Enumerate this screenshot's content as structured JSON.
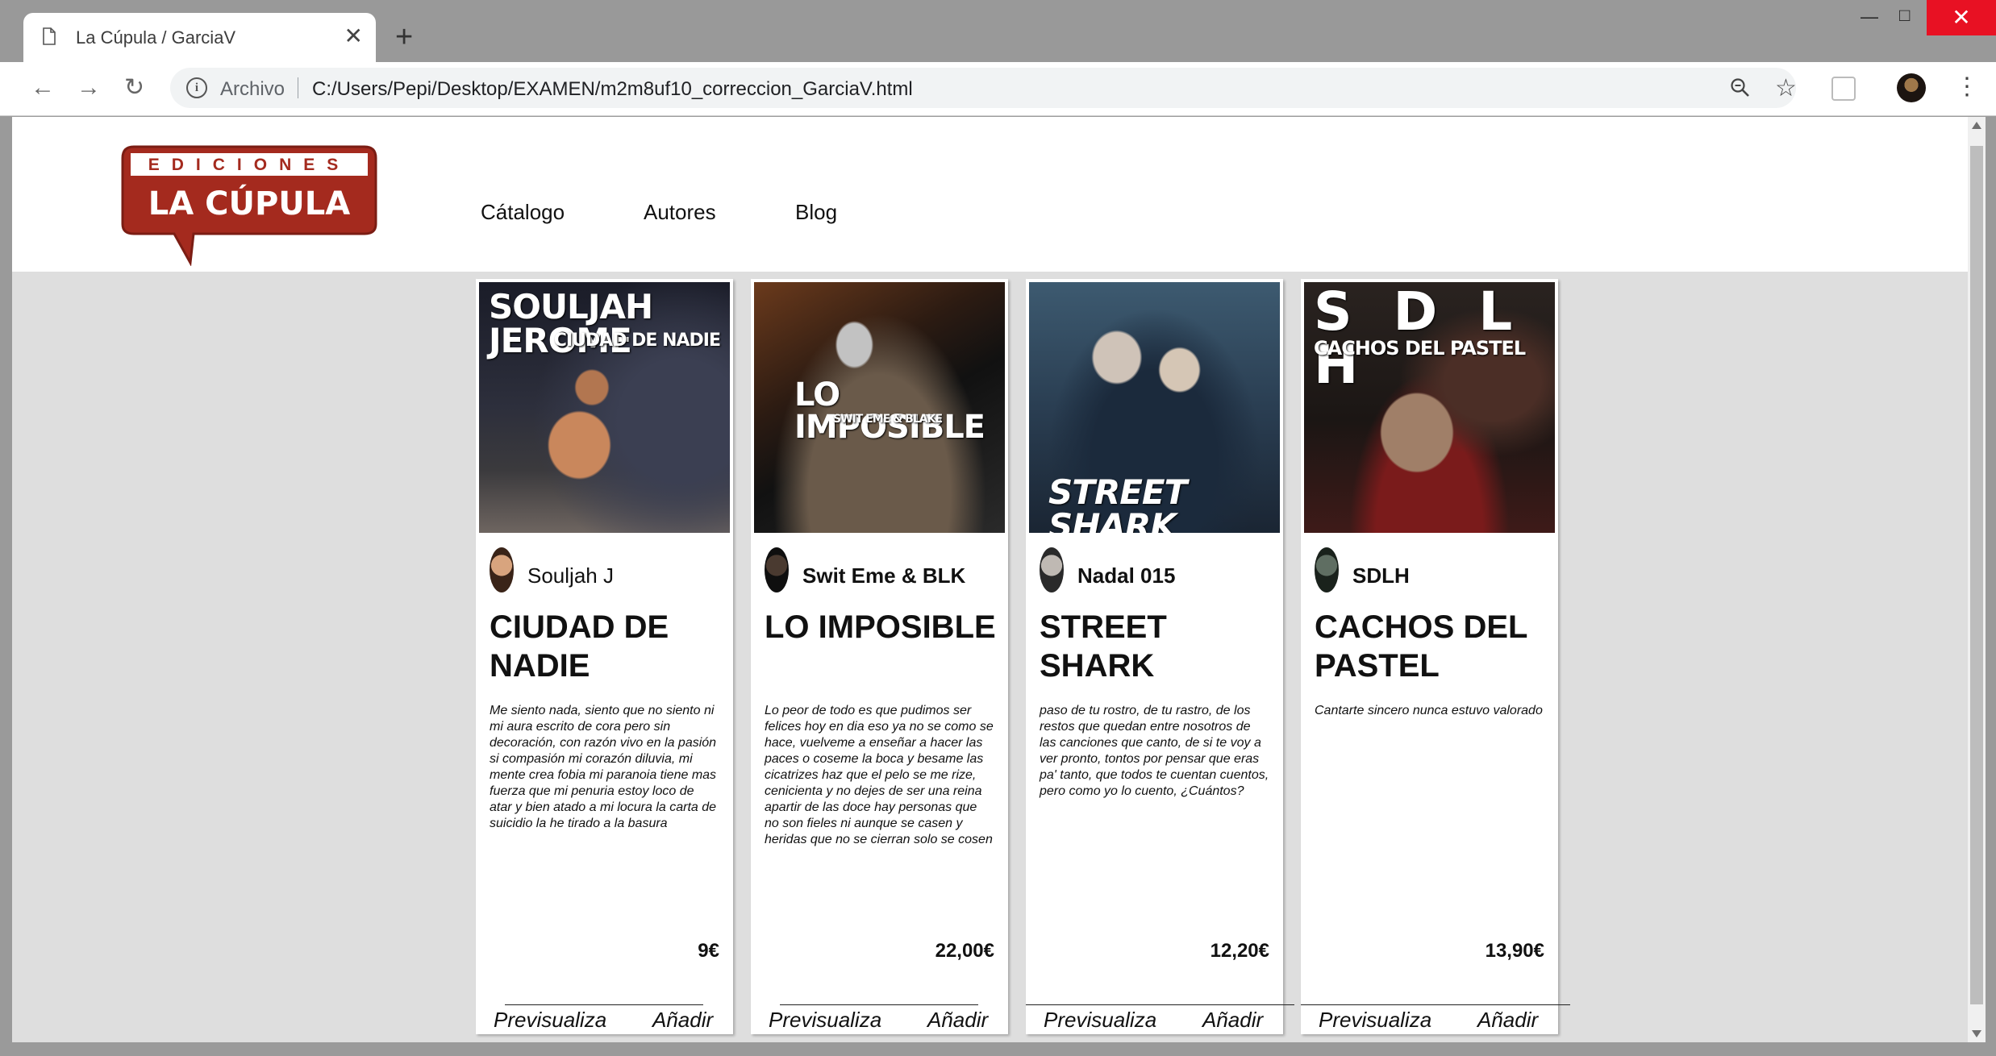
{
  "browser": {
    "tab_title": "La Cúpula / GarciaV",
    "close_glyph": "✕",
    "new_tab_glyph": "+",
    "scheme_label": "Archivo",
    "url": "C:/Users/Pepi/Desktop/EXAMEN/m2m8uf10_correccion_GarciaV.html",
    "icons": [
      "back-icon",
      "forward-icon",
      "reload-icon",
      "info-icon",
      "zoom-icon",
      "star-icon",
      "extension-icon",
      "profile-icon",
      "menu-icon"
    ]
  },
  "site": {
    "logo": {
      "line1": "EDICIONES",
      "line2": "LA CÚPULA",
      "color": "#a42a1e"
    },
    "nav": [
      "Cátalogo",
      "Autores",
      "Blog"
    ]
  },
  "cards": [
    {
      "cover_title": "SOULJAH JEROME",
      "cover_subtitle": "CIUDAD DE NADIE",
      "author": "Souljah J",
      "title": "CIUDAD DE NADIE",
      "description": "Me siento nada, siento que no siento ni mi aura escrito de cora pero sin decoración, con razón vivo en la pasión si compasión mi corazón diluvia, mi mente crea fobia mi paranoia tiene mas fuerza que mi penuria estoy loco de atar y bien atado a mi locura la carta de suicidio la he tirado a la basura",
      "price": "9€",
      "preview_label": "Previsualiza",
      "add_label": "Añadir"
    },
    {
      "cover_title": "LO IMPOSIBLE",
      "cover_subtitle": "SWIT EME & BLAKE",
      "author": "Swit Eme & BLK",
      "title": "LO IMPOSIBLE",
      "description": "Lo peor de todo es que pudimos ser felices hoy en dia eso ya no se como se hace, vuelveme a enseñar a hacer las paces o coseme la boca y besame las cicatrizes haz que el pelo se me rize, cenicienta y no dejes de ser una reina apartir de las doce hay personas que no son fieles ni aunque se casen y heridas que no se cierran solo se cosen",
      "price": "22,00€",
      "preview_label": "Previsualiza",
      "add_label": "Añadir"
    },
    {
      "cover_title": "STREET SHARK",
      "cover_subtitle": "",
      "author": "Nadal 015",
      "title": "STREET SHARK",
      "description": "paso de tu rostro, de tu rastro, de los restos que quedan entre nosotros de las canciones que canto, de si te voy a ver pronto, tontos por pensar que eras pa' tanto, que todos te cuentan cuentos, pero como yo lo cuento, ¿Cuántos?",
      "price": "12,20€",
      "preview_label": "Previsualiza",
      "add_label": "Añadir"
    },
    {
      "cover_title": "S D L H",
      "cover_subtitle": "CACHOS DEL PASTEL",
      "author": "SDLH",
      "title": "CACHOS DEL PASTEL",
      "description": "Cantarte sincero nunca estuvo valorado",
      "price": "13,90€",
      "preview_label": "Previsualiza",
      "add_label": "Añadir"
    }
  ]
}
